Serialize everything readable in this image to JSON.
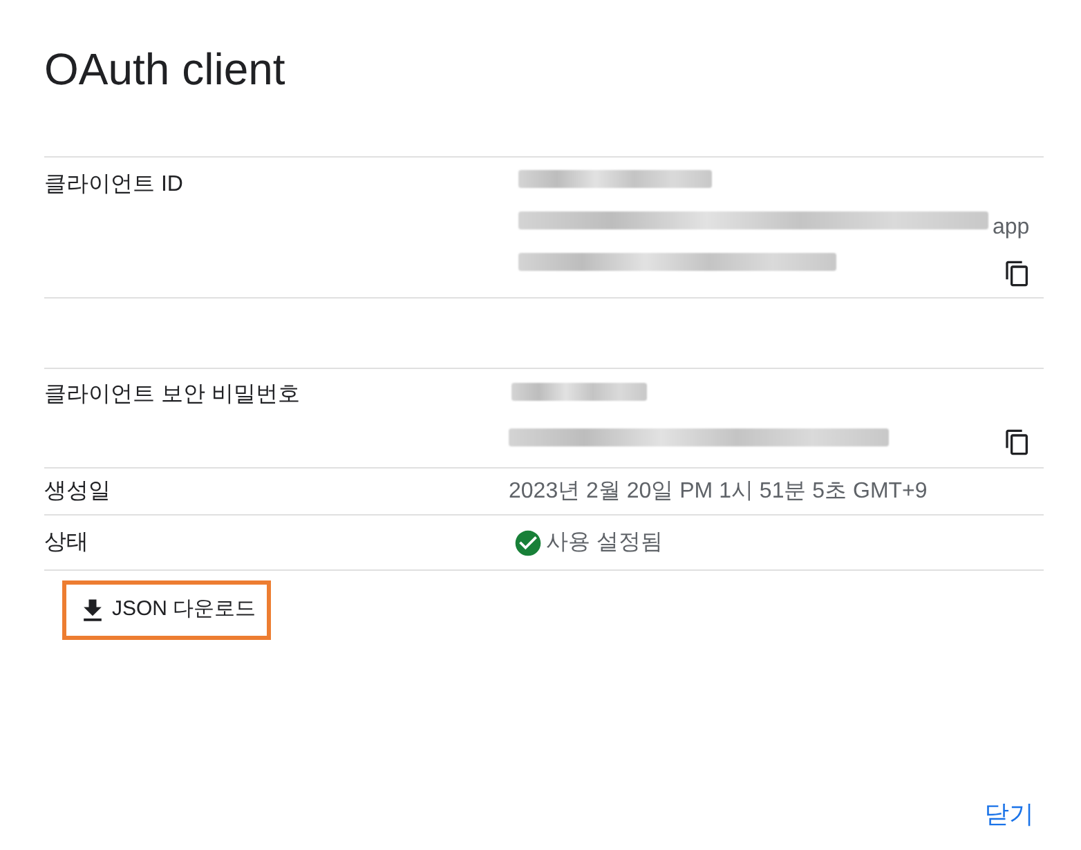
{
  "dialog": {
    "title": "OAuth client"
  },
  "client_id": {
    "label": "클라이언트 ID",
    "value_tail": "app"
  },
  "client_secret": {
    "label": "클라이언트 보안 비밀번호"
  },
  "created": {
    "label": "생성일",
    "value": "2023년 2월 20일 PM 1시 51분 5초 GMT+9"
  },
  "status": {
    "label": "상태",
    "value": "사용 설정됨",
    "enabled": true
  },
  "download_button": {
    "label": "JSON 다운로드",
    "highlighted": true
  },
  "close_button": {
    "label": "닫기"
  }
}
